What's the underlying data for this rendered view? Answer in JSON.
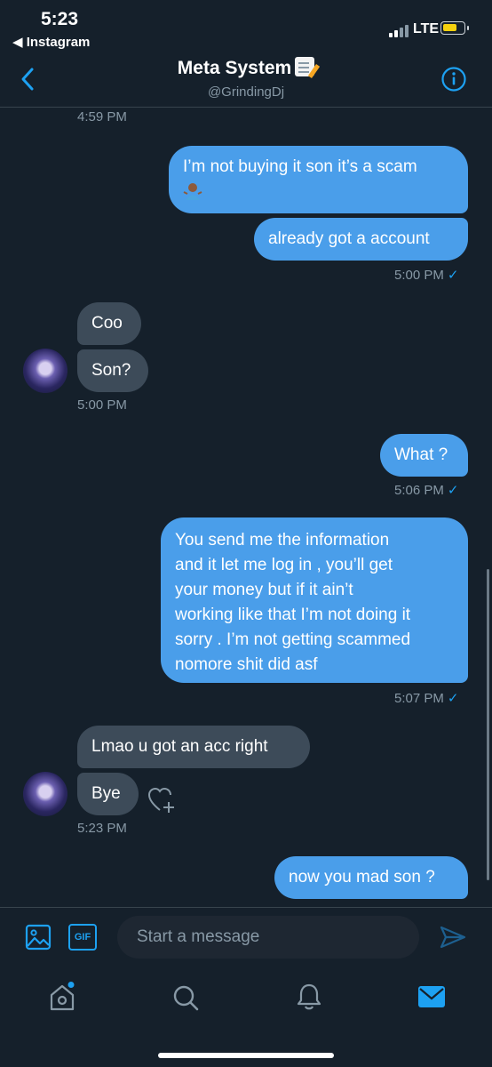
{
  "status_bar": {
    "time": "5:23",
    "back_app": "◀ Instagram",
    "network": "LTE"
  },
  "header": {
    "title": "Meta System",
    "handle": "@GrindingDj"
  },
  "timestamps": {
    "t1": "4:59 PM",
    "t2": "5:00 PM",
    "t3": "5:00 PM",
    "t4": "5:06 PM",
    "t5": "5:07 PM",
    "t6": "5:23 PM"
  },
  "messages": {
    "m1_line1": "I’m not buying it son it’s a scam",
    "m2": "already got a account",
    "m3": "Coo",
    "m4": "Son?",
    "m5": "What ?",
    "m6_lines": [
      "You send me the information",
      "and it let me log in , you’ll get",
      "your money but if it ain’t",
      "working like that I’m not doing it",
      "sorry . I’m not getting scammed",
      "nomore shit did asf"
    ],
    "m7": "Lmao u got an acc right",
    "m8": "Bye",
    "m9": "now you mad son ?"
  },
  "composer": {
    "placeholder": "Start a message",
    "gif_label": "GIF"
  },
  "colors": {
    "background": "#15202b",
    "outgoing": "#4a9eea",
    "incoming": "#3d4b59",
    "accent": "#1da1f2"
  },
  "icons": [
    "back-arrow-icon",
    "info-icon",
    "image-icon",
    "gif-icon",
    "send-icon",
    "home-icon",
    "search-icon",
    "notifications-icon",
    "messages-icon",
    "react-heart-icon"
  ]
}
